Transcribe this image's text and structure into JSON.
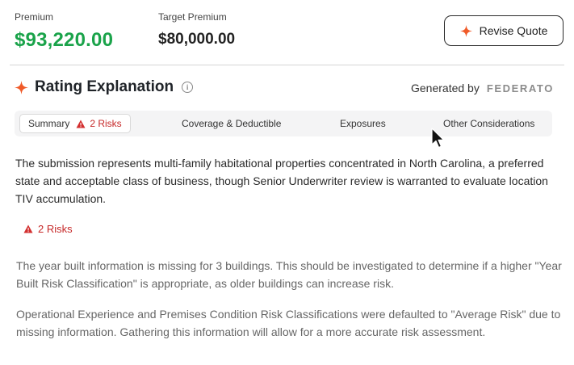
{
  "header": {
    "premium_label": "Premium",
    "premium_value": "$93,220.00",
    "target_label": "Target Premium",
    "target_value": "$80,000.00",
    "revise_button_label": "Revise Quote"
  },
  "rating": {
    "title": "Rating Explanation",
    "generated_by_label": "Generated by",
    "brand": "FEDERATO"
  },
  "tabs": [
    {
      "label": "Summary",
      "risk_count": "2 Risks",
      "active": true
    },
    {
      "label": "Coverage & Deductible"
    },
    {
      "label": "Exposures"
    },
    {
      "label": "Other Considerations"
    }
  ],
  "summary": {
    "text": "The submission represents multi-family habitational properties concentrated in North Carolina, a preferred state and acceptable class of business, though Senior Underwriter review is warranted to evaluate location TIV accumulation.",
    "risk_badge": "2 Risks",
    "risks": [
      "The year built information is missing for 3 buildings. This should be investigated to determine if a higher \"Year Built Risk Classification\" is appropriate, as older buildings can increase risk.",
      "Operational Experience and Premises Condition Risk Classifications were defaulted to \"Average Risk\" due to missing information. Gathering this information will allow for a more accurate risk assessment."
    ]
  },
  "colors": {
    "premium_green": "#1aa34a",
    "accent_orange": "#f05a28",
    "risk_red": "#c62828"
  },
  "icons": {
    "sparkle": "sparkle-icon",
    "info": "info-icon",
    "warning": "warning-icon",
    "cursor": "mouse-cursor-icon"
  }
}
